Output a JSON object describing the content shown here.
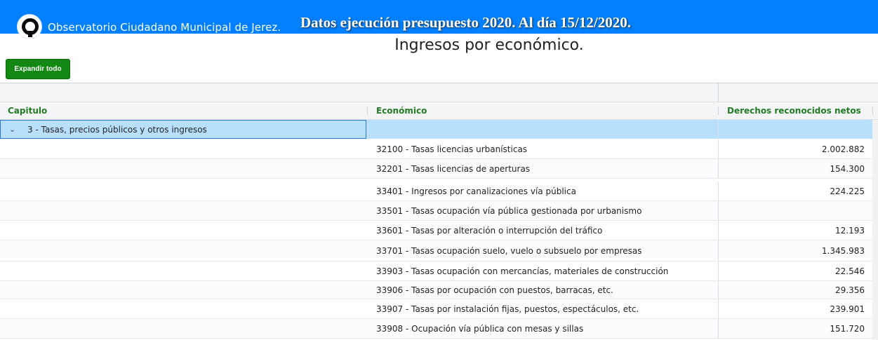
{
  "header": {
    "site_name": "Observatorio Ciudadano Municipal de Jerez.",
    "headline": "Datos ejecución presupuesto 2020. Al día 15/12/2020.",
    "logo_icon": "eye-logo-icon"
  },
  "page_title": "Ingresos por económico.",
  "toolbar": {
    "expand_all_label": "Expandir todo"
  },
  "colors": {
    "topbar": "#0080ff",
    "button": "#128712",
    "header_text": "#237b23",
    "group_row": "#b8e0fd"
  },
  "table": {
    "columns": [
      "Capitulo",
      "Económico",
      "Derechos reconocidos netos"
    ],
    "group": {
      "label": "3 - Tasas, precios públicos y otros ingresos",
      "expanded": true,
      "icon": "chevron-down-icon"
    },
    "rows": [
      {
        "economico": "32100 - Tasas licencias urbanísticas",
        "derechos": "2.002.882"
      },
      {
        "economico": "32201 - Tasas licencias de aperturas",
        "derechos": "154.300"
      },
      {
        "economico": "33401 - Ingresos por canalizaciones vía pública",
        "derechos": "224.225"
      },
      {
        "economico": "33501 - Tasas ocupación vía pública gestionada por urbanismo",
        "derechos": ""
      },
      {
        "economico": "33601 - Tasas por alteración o interrupción del tráfico",
        "derechos": "12.193"
      },
      {
        "economico": "33701 - Tasas ocupación suelo, vuelo o subsuelo por empresas",
        "derechos": "1.345.983"
      },
      {
        "economico": "33903 - Tasas ocupación con mercancías, materiales de construcción",
        "derechos": "22.546"
      },
      {
        "economico": "33906 - Tasas por ocupación con puestos, barracas, etc.",
        "derechos": "29.356"
      },
      {
        "economico": "33907 - Tasas por instalación fijas, puestos, espectáculos, etc.",
        "derechos": "239.901"
      },
      {
        "economico": "33908 - Ocupación vía pública con mesas y sillas",
        "derechos": "151.720"
      }
    ]
  }
}
